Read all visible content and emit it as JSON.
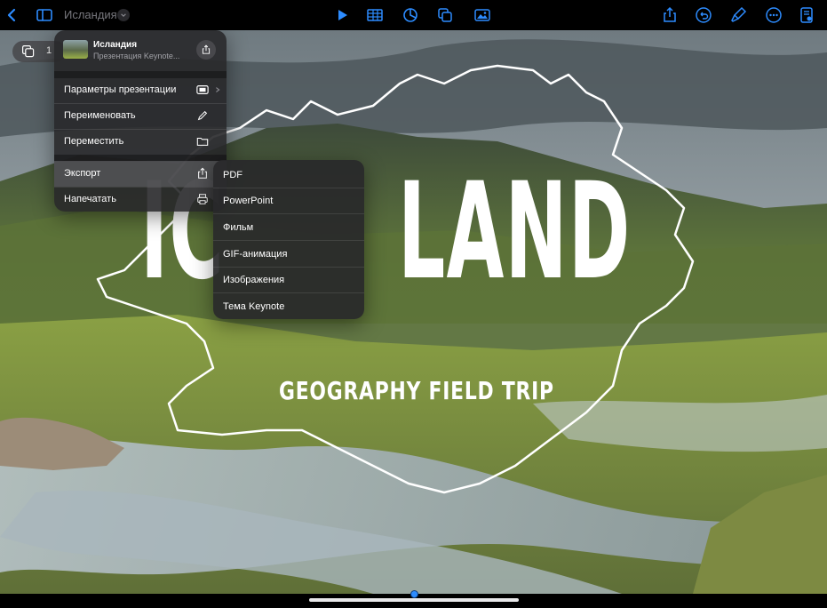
{
  "toolbar": {
    "doc_title": "Исландия",
    "icons": [
      "back-icon",
      "sidebar-icon",
      "play-icon",
      "table-icon",
      "chart-icon",
      "shapes-icon",
      "media-icon",
      "share-icon",
      "undo-icon",
      "brush-icon",
      "more-icon",
      "doc-options-icon"
    ]
  },
  "slide": {
    "title": "IC LAND",
    "title_left": "IC",
    "title_right": "LAND",
    "subtitle": "GEOGRAPHY FIELD TRIP",
    "slide_number": "1"
  },
  "menu": {
    "head_title": "Исландия",
    "head_subtitle": "Презентация Keynote...",
    "items": [
      {
        "label": "Параметры презентации",
        "icon": "presentation-settings-icon"
      },
      {
        "label": "Переименовать",
        "icon": "pencil-icon"
      },
      {
        "label": "Переместить",
        "icon": "folder-icon"
      },
      {
        "label": "Экспорт",
        "icon": "export-icon"
      },
      {
        "label": "Напечатать",
        "icon": "printer-icon"
      }
    ]
  },
  "export_submenu": {
    "items": [
      "PDF",
      "PowerPoint",
      "Фильм",
      "GIF-анимация",
      "Изображения",
      "Тема Keynote"
    ]
  },
  "colors": {
    "accent": "#2d8cff",
    "menu_bg": "#28282a"
  }
}
